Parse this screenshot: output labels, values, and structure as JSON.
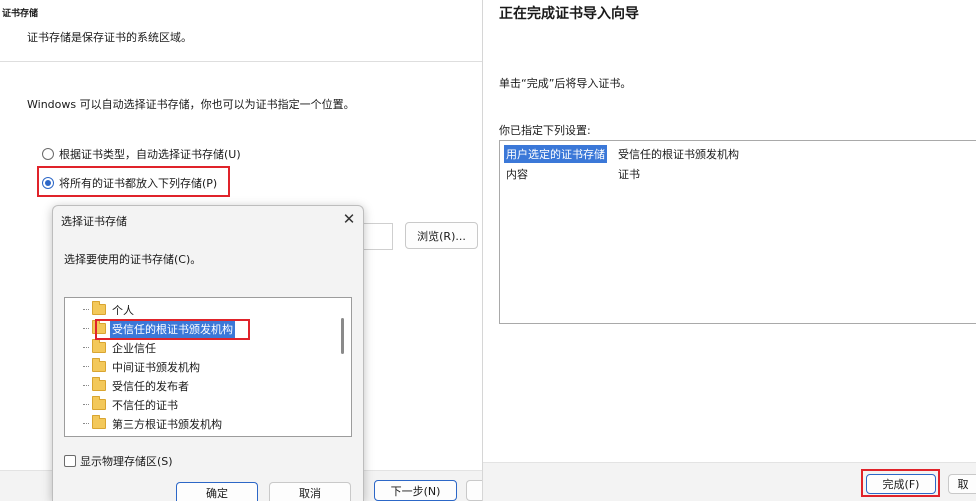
{
  "left_wizard": {
    "section_title": "证书存储",
    "section_desc": "证书存储是保存证书的系统区域。",
    "auto_text": "Windows 可以自动选择证书存储，你也可以为证书指定一个位置。",
    "radio_auto": "根据证书类型，自动选择证书存储(U)",
    "radio_manual": "将所有的证书都放入下列存储(P)",
    "browse_button": "浏览(R)...",
    "next_button": "下一步(N)"
  },
  "select_store_dialog": {
    "title": "选择证书存储",
    "prompt": "选择要使用的证书存储(C)。",
    "stores": [
      "个人",
      "受信任的根证书颁发机构",
      "企业信任",
      "中间证书颁发机构",
      "受信任的发布者",
      "不信任的证书",
      "第三方根证书颁发机构"
    ],
    "show_physical": "显示物理存储区(S)",
    "ok_button": "确定",
    "cancel_button": "取消"
  },
  "finish_wizard": {
    "title": "正在完成证书导入向导",
    "desc": "单击“完成”后将导入证书。",
    "settings_label": "你已指定下列设置:",
    "settings": [
      {
        "key": "用户选定的证书存储",
        "value": "受信任的根证书颁发机构"
      },
      {
        "key": "内容",
        "value": "证书"
      }
    ],
    "finish_button": "完成(F)",
    "cancel_button_partial": "取"
  },
  "colors": {
    "accent": "#2c67c7",
    "highlight": "#e0232a",
    "selection": "#3b78d8"
  },
  "icons": {
    "close": "close-icon",
    "folder": "folder-icon"
  }
}
